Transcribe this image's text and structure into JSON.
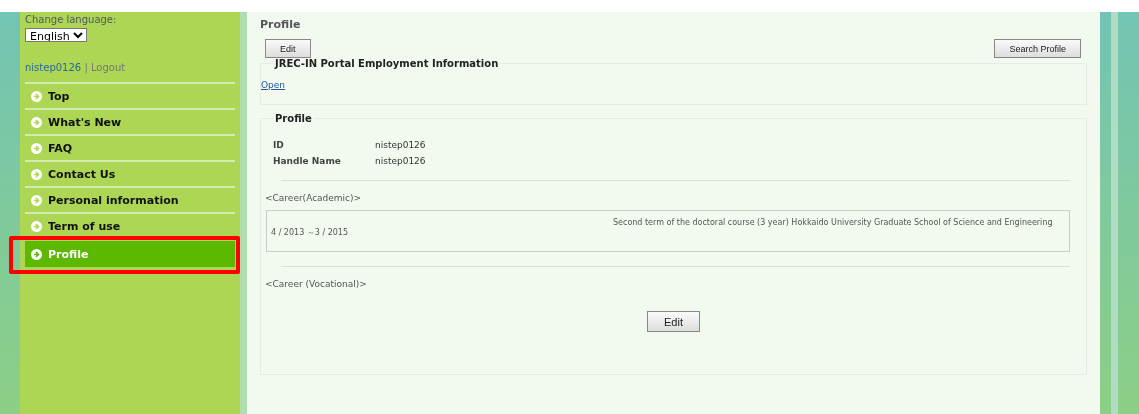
{
  "sidebar": {
    "language_label": "Change language:",
    "language": "English",
    "user": "nistep0126",
    "separator": "|",
    "logout": "Logout",
    "items": [
      {
        "label": "Top",
        "selected": false,
        "highlighted": false
      },
      {
        "label": "What's New",
        "selected": false,
        "highlighted": false
      },
      {
        "label": "FAQ",
        "selected": false,
        "highlighted": false
      },
      {
        "label": "Contact Us",
        "selected": false,
        "highlighted": false
      },
      {
        "label": "Personal information",
        "selected": false,
        "highlighted": false
      },
      {
        "label": "Term of use",
        "selected": false,
        "highlighted": false
      },
      {
        "label": "Profile",
        "selected": true,
        "highlighted": true
      }
    ]
  },
  "main": {
    "title": "Profile",
    "edit_button": "Edit",
    "search_button": "Search Profile",
    "jrec": {
      "legend": "JREC-IN Portal Employment Information",
      "link": "Open"
    },
    "profile": {
      "legend": "Profile",
      "fields": [
        {
          "label": "ID",
          "value": "nistep0126"
        },
        {
          "label": "Handle Name",
          "value": "nistep0126"
        }
      ],
      "academic_heading": "<Career(Academic)>",
      "academic": [
        {
          "period": "4  / 2013  ～3  / 2015",
          "description": "Second term of the doctoral course (3 year) Hokkaido University Graduate School of Science and Engineering"
        }
      ],
      "vocational_heading": "<Career (Vocational)>",
      "edit_button": "Edit"
    }
  }
}
